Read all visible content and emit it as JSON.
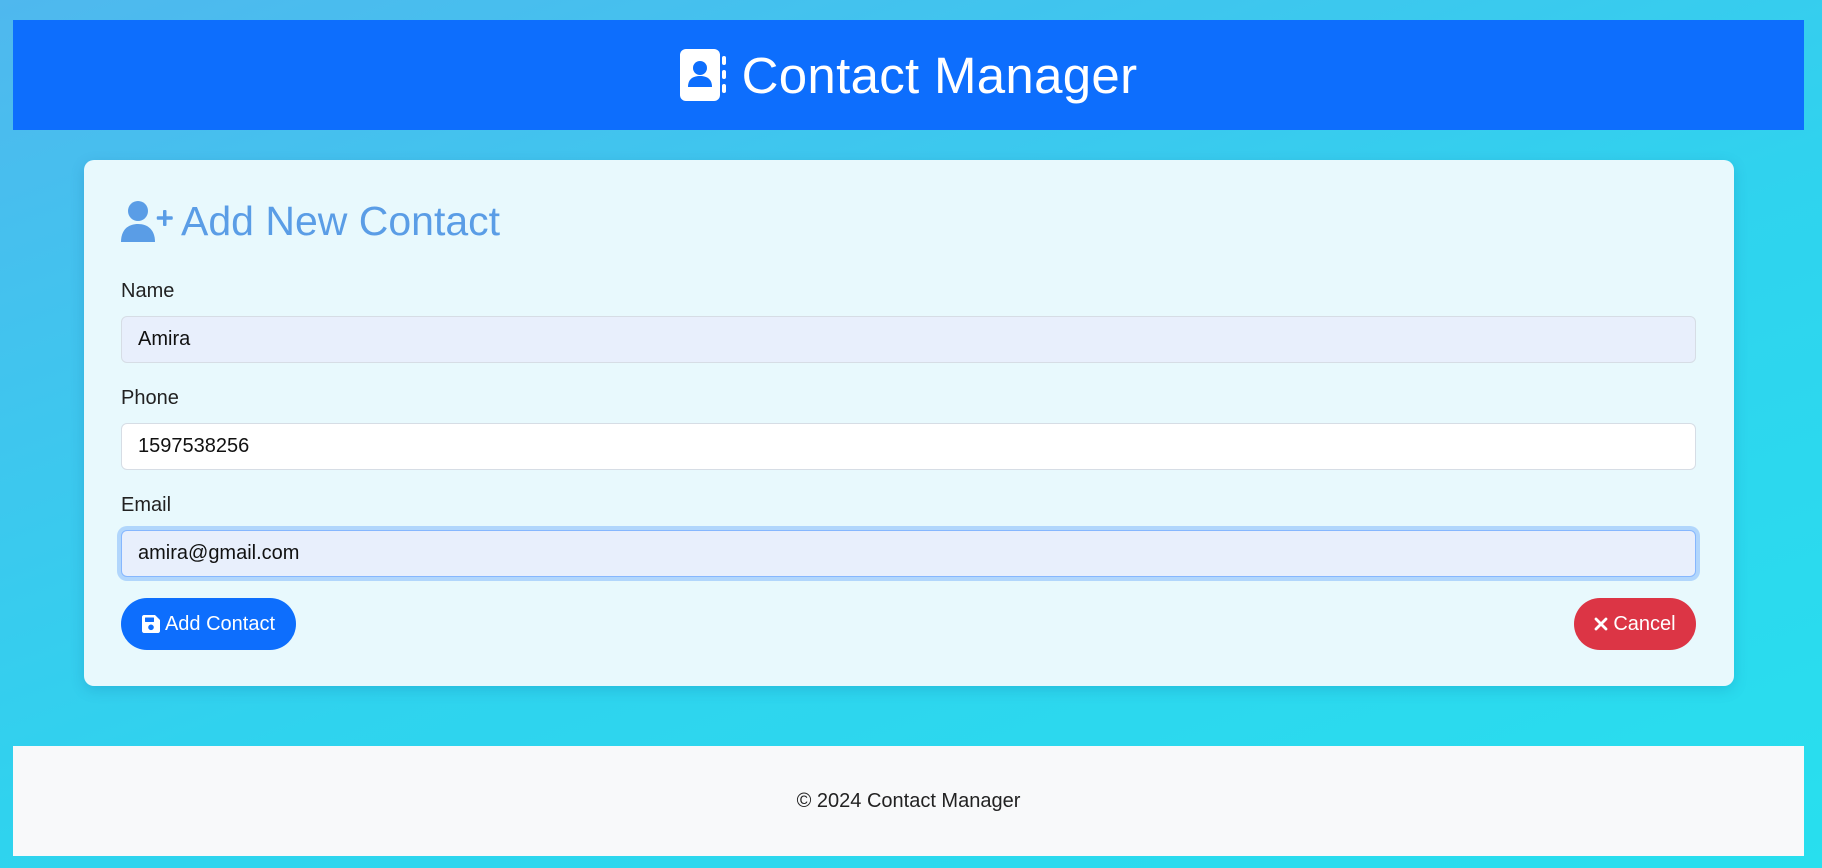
{
  "header": {
    "title": "Contact Manager",
    "icon": "address-book-icon"
  },
  "form": {
    "title": "Add New Contact",
    "title_icon": "user-plus-icon",
    "fields": {
      "name": {
        "label": "Name",
        "value": "Amira"
      },
      "phone": {
        "label": "Phone",
        "value": "1597538256"
      },
      "email": {
        "label": "Email",
        "value": "amira@gmail.com"
      }
    },
    "buttons": {
      "add": {
        "label": "Add Contact",
        "icon": "save-icon"
      },
      "cancel": {
        "label": "Cancel",
        "icon": "close-icon"
      }
    }
  },
  "footer": {
    "text": "© 2024 Contact Manager"
  },
  "colors": {
    "primary": "#0d6efd",
    "danger": "#dc3545",
    "title_accent": "#5a9de6",
    "card_background": "#e8f9fd",
    "footer_background": "#f8f9fa"
  }
}
